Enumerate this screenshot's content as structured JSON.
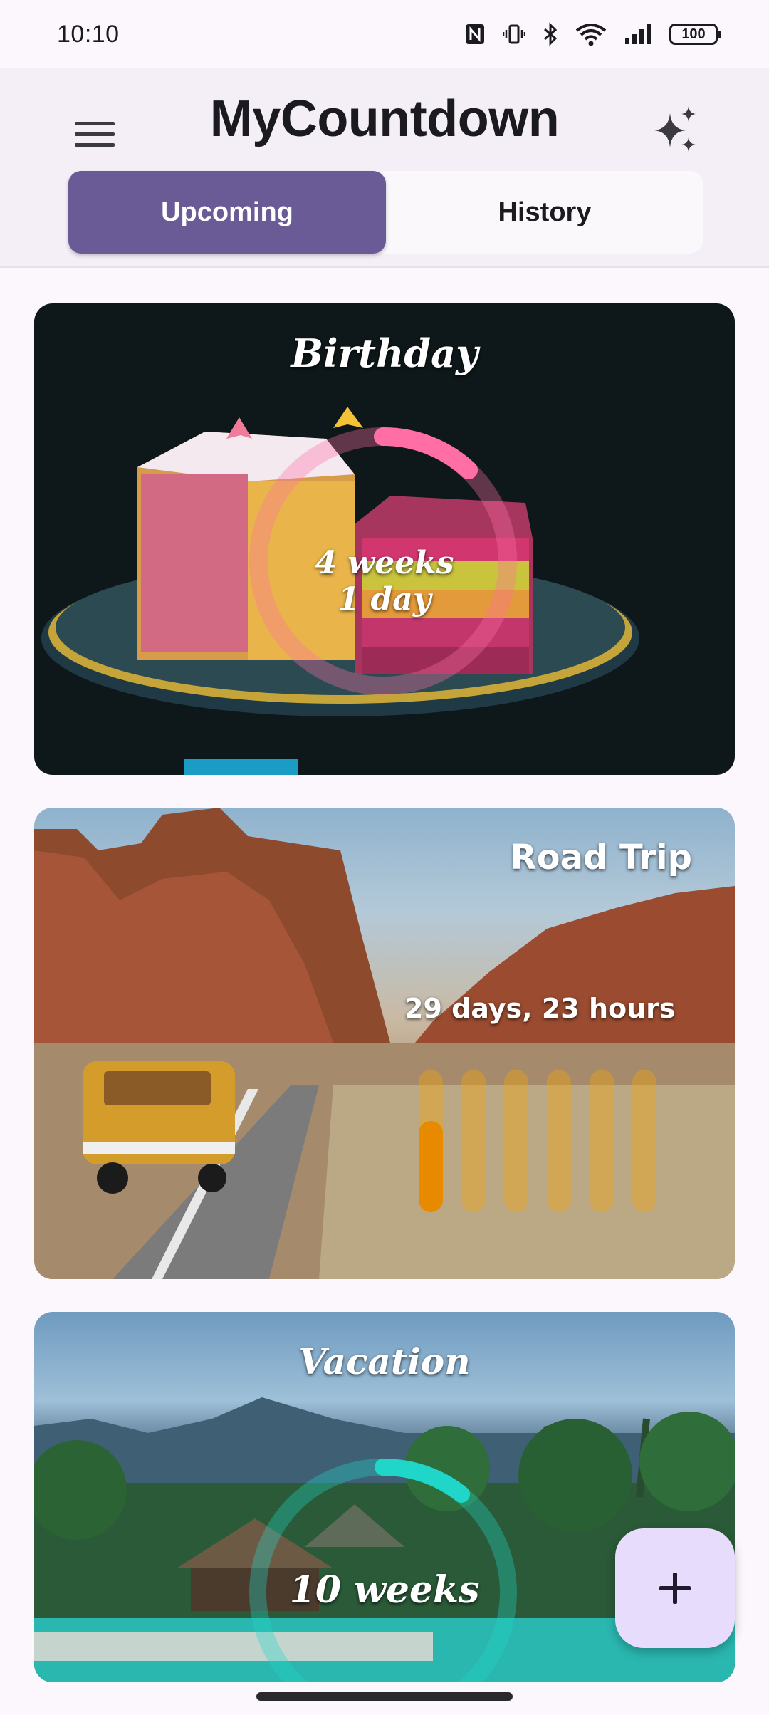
{
  "status_bar": {
    "time": "10:10",
    "battery": "100",
    "icons": [
      "nfc-icon",
      "vibrate-icon",
      "bluetooth-icon",
      "wifi-icon",
      "signal-icon",
      "battery-icon"
    ]
  },
  "app": {
    "title": "MyCountdown",
    "menu_icon": "hamburger-menu-icon",
    "action_icon": "sparkle-icon"
  },
  "tabs": [
    {
      "label": "Upcoming",
      "selected": true
    },
    {
      "label": "History",
      "selected": false
    }
  ],
  "countdowns": [
    {
      "title": "Birthday",
      "remaining_line1": "4 weeks",
      "remaining_line2": "1 day",
      "indicator": "ring",
      "accent": "#ff6fa6",
      "progress": 0.18
    },
    {
      "title": "Road Trip",
      "remaining": "29 days, 23 hours",
      "indicator": "bars",
      "accent": "#f2a20d",
      "bar_levels": [
        0.6,
        0,
        0,
        0,
        0,
        0
      ]
    },
    {
      "title": "Vacation",
      "remaining": "10 weeks",
      "indicator": "ring",
      "accent": "#1fd6c9",
      "progress": 0.12
    }
  ],
  "fab": {
    "icon": "plus-icon",
    "color": "#e8dcfd"
  },
  "colors": {
    "primary": "#6a5a95",
    "background": "#fbf7fd",
    "header": "#f4eff7"
  }
}
